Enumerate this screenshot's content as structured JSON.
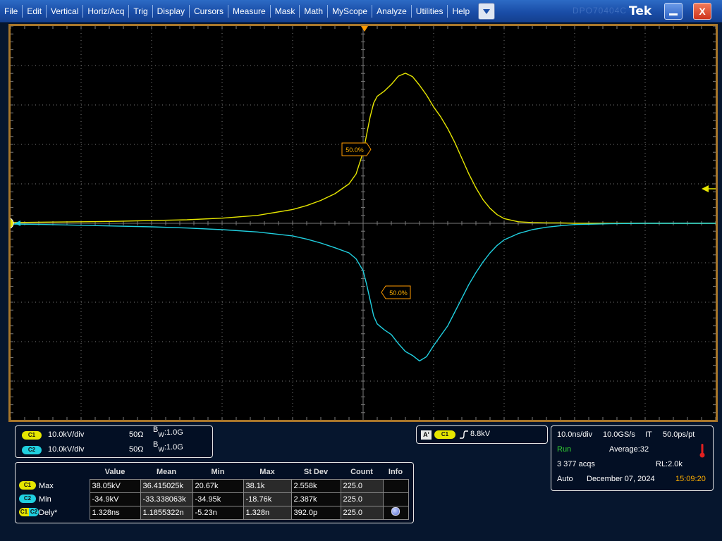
{
  "menubar": {
    "items": [
      "File",
      "Edit",
      "Vertical",
      "Horiz/Acq",
      "Trig",
      "Display",
      "Cursors",
      "Measure",
      "Mask",
      "Math",
      "MyScope",
      "Analyze",
      "Utilities",
      "Help"
    ],
    "logo": "Tek",
    "brand": "DPO70404C",
    "close_label": "X",
    "dropdown_icon": "triangle-down-icon",
    "minimize_icon": "minimize-icon",
    "close_icon": "close-icon"
  },
  "graticule": {
    "background": "#000000",
    "grid_color": "#7a7a7a",
    "ch1_marker": "1",
    "ch1_ref_label": "50.0%",
    "ch2_ref_label": "50.0%"
  },
  "chart_data": {
    "type": "line",
    "x": [
      -50,
      -45,
      -40,
      -35,
      -30,
      -25,
      -20,
      -15,
      -10,
      -8,
      -6,
      -4,
      -2,
      -1,
      0,
      0.5,
      1,
      1.5,
      2,
      3,
      4,
      5,
      6,
      7,
      8,
      9,
      10,
      11,
      12,
      13,
      14,
      15,
      16,
      17,
      18,
      19,
      20,
      22,
      24,
      26,
      28,
      30,
      33,
      35,
      40,
      45,
      50
    ],
    "xunit": "ns",
    "xlim": [
      -50,
      50
    ],
    "ylim": [
      -50,
      50
    ],
    "yunit": "kV",
    "series": [
      {
        "color": "#e6e600",
        "values": [
          0.2,
          0.3,
          0.4,
          0.5,
          0.7,
          0.9,
          1.3,
          2.0,
          3.5,
          4.5,
          5.8,
          7.5,
          10,
          12.5,
          18,
          22.5,
          27,
          30.5,
          32.2,
          33.5,
          35.2,
          37.3,
          38.05,
          37.2,
          35,
          32.5,
          29.5,
          27,
          24,
          20.5,
          16.5,
          12.5,
          9,
          6,
          3.8,
          2.2,
          1.2,
          0.4,
          0.2,
          0.1,
          0.1,
          0,
          0,
          0,
          0,
          0,
          0
        ]
      },
      {
        "color": "#20d0e0",
        "values": [
          -0.2,
          -0.3,
          -0.5,
          -0.7,
          -0.9,
          -1.2,
          -1.6,
          -2.2,
          -3.2,
          -4,
          -5,
          -6.2,
          -7.5,
          -9,
          -12,
          -15.5,
          -19.5,
          -23.5,
          -25.5,
          -27,
          -28.2,
          -30.5,
          -32.5,
          -33.5,
          -34.9,
          -33.8,
          -31,
          -28.5,
          -26,
          -22.5,
          -19,
          -15.5,
          -12.5,
          -9.8,
          -7.5,
          -5.6,
          -4.2,
          -2.6,
          -1.6,
          -1.0,
          -0.6,
          -0.3,
          -0.2,
          -0.1,
          0,
          0,
          0
        ]
      }
    ]
  },
  "channels": [
    {
      "badge": "C1",
      "scale": "10.0kV/div",
      "impedance": "50Ω",
      "bw_prefix": "B",
      "bw_sub": "W",
      "bw_value": ":1.0G"
    },
    {
      "badge": "C2",
      "scale": "10.0kV/div",
      "impedance": "50Ω",
      "bw_prefix": "B",
      "bw_sub": "W",
      "bw_value": ":1.0G"
    }
  ],
  "trigger": {
    "mode_badge": "A'",
    "source_badge": "C1",
    "slope_icon": "rising-edge-icon",
    "level": "8.8kV"
  },
  "acquisition": {
    "timebase": "10.0ns/div",
    "sample_rate": "10.0GS/s",
    "mode": "IT",
    "resolution": "50.0ps/pt",
    "status": "Run",
    "status_color": "#32d232",
    "average": "Average:32",
    "acqs": "3 377 acqs",
    "record_length": "RL:2.0k",
    "trigger_mode": "Auto",
    "date": "December 07, 2024",
    "time": "15:09:20",
    "time_color": "#ffb000",
    "thermo_icon": "thermometer-icon"
  },
  "measurements": {
    "headers": [
      "Value",
      "Mean",
      "Min",
      "Max",
      "St Dev",
      "Count",
      "Info"
    ],
    "rows": [
      {
        "badge": "C1",
        "name": "Max",
        "value": "38.05kV",
        "mean": "36.415025k",
        "min": "20.67k",
        "max": "38.1k",
        "stdev": "2.558k",
        "count": "225.0",
        "info": ""
      },
      {
        "badge": "C2",
        "name": "Min",
        "value": "-34.9kV",
        "mean": "-33.338063k",
        "min": "-34.95k",
        "max": "-18.76k",
        "stdev": "2.387k",
        "count": "225.0",
        "info": ""
      },
      {
        "badge_a": "C1",
        "badge_b": "C2",
        "name": "Dely*",
        "value": "1.328ns",
        "mean": "1.1855322n",
        "min": "-5.23n",
        "max": "1.328n",
        "stdev": "392.0p",
        "count": "225.0",
        "info_icon": "info-icon"
      }
    ]
  }
}
